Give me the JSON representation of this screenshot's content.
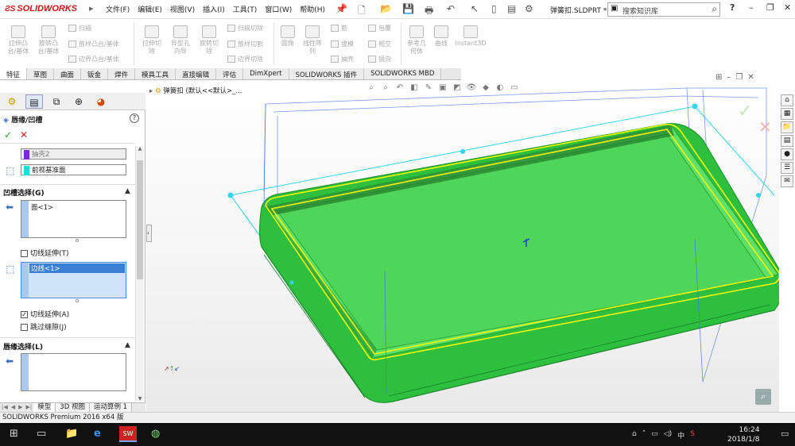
{
  "app": {
    "brand": "SOLIDWORKS",
    "menu": [
      "文件(F)",
      "编辑(E)",
      "视图(V)",
      "插入(I)",
      "工具(T)",
      "窗口(W)",
      "帮助(H)"
    ],
    "doc_name": "弹簧扣.SLDPRT *",
    "search_placeholder": "搜索知识库",
    "help": "?"
  },
  "ribbon": {
    "big_tools": [
      "拉伸凸\n台/基体",
      "旋转凸\n台/基体",
      "拉伸切\n除",
      "异型孔\n向导",
      "旋转切\n除",
      "圆角",
      "线性阵\n列",
      "参考几\n何体",
      "曲线",
      "Instant3D"
    ],
    "small_tools_a": [
      "扫描",
      "放样凸台/基体",
      "边界凸台/基体"
    ],
    "small_tools_b": [
      "扫描切除",
      "放样切割",
      "边界切除"
    ],
    "small_tools_c": [
      "筋",
      "拔模",
      "抽壳"
    ],
    "small_tools_d": [
      "包覆",
      "相交",
      "镜向"
    ]
  },
  "tabs": [
    "特征",
    "草图",
    "曲面",
    "钣金",
    "焊件",
    "模具工具",
    "直接编辑",
    "评估",
    "DimXpert",
    "SOLIDWORKS 插件",
    "SOLIDWORKS MBD"
  ],
  "panel": {
    "title": "唇缘/凹槽",
    "body_field": "抽壳2",
    "plane_field": "前视基准面",
    "groove_section": "凹槽选择(G)",
    "groove_face": "面<1>",
    "groove_tangent": "切线延伸(T)",
    "groove_edge": "边线<1>",
    "groove_edge_tangent": "切线延伸(A)",
    "skip_gaps": "跳过缝隙(J)",
    "lip_section": "唇缘选择(L)"
  },
  "bottom_tabs": [
    "模型",
    "3D 视图",
    "运动算例 1"
  ],
  "status": "SOLIDWORKS Premium 2016 x64 版",
  "tree_label": "弹簧扣  (默认<<默认>_...",
  "clock": {
    "time": "16:24",
    "date": "2018/1/8"
  },
  "tray_lang": "中",
  "colors": {
    "accent": "#d0121a",
    "model_green": "#2ecc40",
    "edge_yellow": "#f5f500",
    "plane_cyan": "#40e0f0"
  },
  "icons": [
    "ok-check-icon",
    "cancel-x-icon",
    "help-icon",
    "search-icon",
    "windows-start-icon"
  ]
}
